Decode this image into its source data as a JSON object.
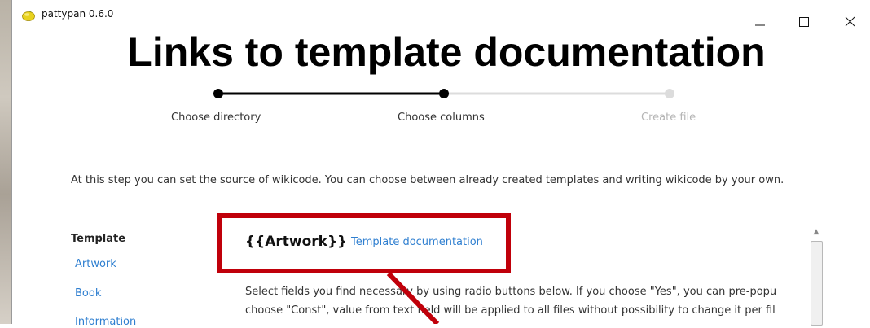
{
  "window": {
    "app_title": "pattypan 0.6.0",
    "app_icon": "lemon-icon",
    "controls": {
      "minimize": "minimize-icon",
      "maximize": "maximize-icon",
      "close": "close-icon"
    }
  },
  "annotation": {
    "title": "Links to template documentation",
    "highlight_color": "#c0000a"
  },
  "stepper": {
    "steps": [
      {
        "label": "Choose directory",
        "state": "done"
      },
      {
        "label": "Choose columns",
        "state": "current"
      },
      {
        "label": "Create file",
        "state": "pending"
      }
    ]
  },
  "intro_text": "At this step you can set the source of wikicode. You can choose between already created templates and writing wikicode by your own.",
  "sidebar": {
    "heading": "Template",
    "items": [
      "Artwork",
      "Book",
      "Information"
    ]
  },
  "template_panel": {
    "name": "{{Artwork}}",
    "doc_link": "Template documentation",
    "description_line1": "Select fields you find necessary by using radio buttons below. If you choose \"Yes\", you can pre-popu",
    "description_line2": "choose \"Const\", value from text field will be applied to all files without possibility to change it per fil"
  },
  "colors": {
    "link": "#2f7fd0",
    "step_active": "#000000",
    "step_inactive": "#d9d9d9"
  }
}
